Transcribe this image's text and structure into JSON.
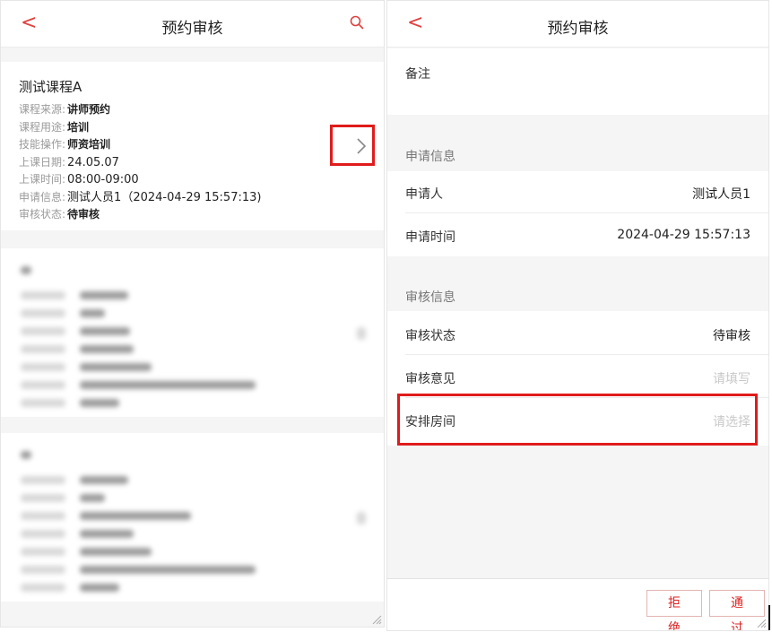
{
  "left": {
    "nav": {
      "back": "<",
      "title": "预约审核"
    },
    "card": {
      "title": "测试课程A",
      "rows": [
        {
          "k": "课程来源:",
          "v": "讲师预约"
        },
        {
          "k": "课程用途:",
          "v": "培训"
        },
        {
          "k": "技能操作:",
          "v": "师资培训"
        },
        {
          "k": "上课日期:",
          "v": "24.05.07"
        },
        {
          "k": "上课时间:",
          "v": "08:00-09:00"
        },
        {
          "k": "申请信息:",
          "v": "测试人员1（2024-04-29 15:57:13)"
        },
        {
          "k": "审核状态:",
          "v": "待审核"
        }
      ]
    }
  },
  "right": {
    "nav": {
      "back": "<",
      "title": "预约审核"
    },
    "remark_label": "备注",
    "apply_section": "申请信息",
    "applicant_label": "申请人",
    "applicant_value": "测试人员1",
    "apply_time_label": "申请时间",
    "apply_time_value": "2024-04-29 15:57:13",
    "review_section": "审核信息",
    "status_label": "审核状态",
    "status_value": "待审核",
    "opinion_label": "审核意见",
    "opinion_placeholder": "请填写",
    "room_label": "安排房间",
    "room_placeholder": "请选择",
    "reject_label": "拒绝",
    "approve_label": "通过"
  },
  "colors": {
    "accent": "#e04040",
    "highlight_box": "#e01b1b"
  }
}
